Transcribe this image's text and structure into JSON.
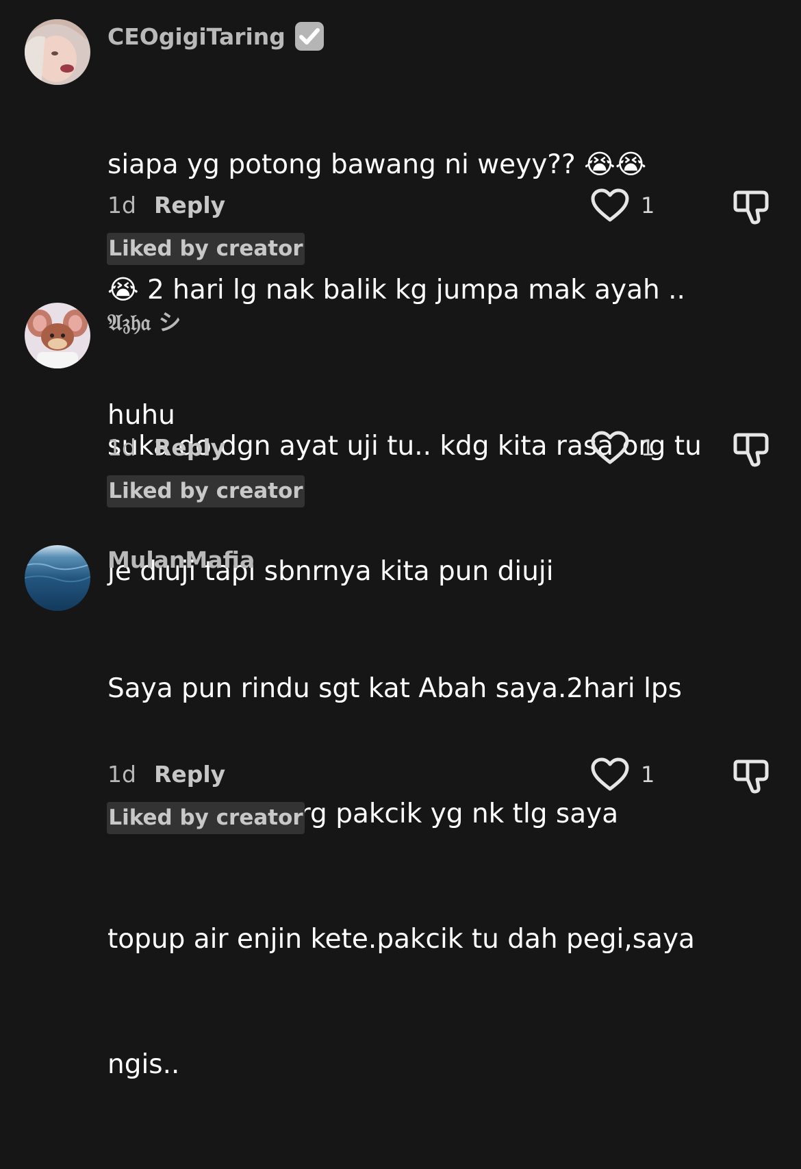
{
  "comments": [
    {
      "username": "CEOgigiTaring",
      "verified": true,
      "avatar": "avatar-person-icon",
      "lines": [
        "siapa yg potong bawang ni weyy?? 😭😭",
        "😭 2 hari lg nak balik kg jumpa mak ayah ..",
        "huhu"
      ],
      "time": "1d",
      "reply_label": "Reply",
      "likes": "1",
      "badge": "Liked by creator"
    },
    {
      "username": "𝔄𝔷𝔥𝔞 シ",
      "verified": false,
      "avatar": "avatar-cartoon-mouse-icon",
      "lines": [
        "suka do dgn ayat uji tu.. kdg kita rasa org tu",
        "je diuji tapi sbnrnya kita pun diuji"
      ],
      "time": "1d",
      "reply_label": "Reply",
      "likes": "1",
      "badge": "Liked by creator"
    },
    {
      "username": "MulanMafia",
      "verified": false,
      "avatar": "avatar-ocean-icon",
      "lines": [
        "Saya pun rindu sgt kat Abah saya.2hari lps",
        "terserempk sorg pakcik yg nk tlg saya",
        "topup air enjin kete.pakcik tu dah pegi,saya",
        "ngis.."
      ],
      "time": "1d",
      "reply_label": "Reply",
      "likes": "1",
      "badge": "Liked by creator"
    }
  ],
  "colors": {
    "background": "#161616",
    "username": "#b9b9b9",
    "badge_bg": "#333333"
  }
}
